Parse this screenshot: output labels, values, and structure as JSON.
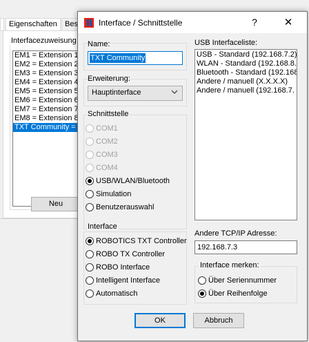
{
  "parent_window": {
    "tabs": [
      "Eigenschaften",
      "Besc"
    ],
    "left_tab_fragment": "",
    "group_label": "Interfacezuweisung",
    "list_items": [
      "EM1 = Extension 1",
      "EM2 = Extension 2",
      "EM3 = Extension 3",
      "EM4 = Extension 4",
      "EM5 = Extension 5",
      "EM6 = Extension 6",
      "EM7 = Extension 7",
      "EM8 = Extension 8",
      "TXT Community = T"
    ],
    "selected_index": 8,
    "new_button": "Neu"
  },
  "dialog": {
    "title": "Interface / Schnittstelle",
    "help_glyph": "?",
    "close_glyph": "✕",
    "name_label": "Name:",
    "name_value": "TXT Community",
    "extension_label": "Erweiterung:",
    "extension_value": "Hauptinterface",
    "port_group_label": "Schnittstelle",
    "port_options": [
      {
        "label": "COM1",
        "enabled": false,
        "checked": false
      },
      {
        "label": "COM2",
        "enabled": false,
        "checked": false
      },
      {
        "label": "COM3",
        "enabled": false,
        "checked": false
      },
      {
        "label": "COM4",
        "enabled": false,
        "checked": false
      },
      {
        "label": "USB/WLAN/Bluetooth",
        "enabled": true,
        "checked": true
      },
      {
        "label": "Simulation",
        "enabled": true,
        "checked": false
      },
      {
        "label": "Benutzerauswahl",
        "enabled": true,
        "checked": false
      }
    ],
    "interface_group_label": "Interface",
    "interface_options": [
      {
        "label": "ROBOTICS TXT Controller",
        "checked": true
      },
      {
        "label": "ROBO TX Controller",
        "checked": false
      },
      {
        "label": "ROBO Interface",
        "checked": false
      },
      {
        "label": "Intelligent Interface",
        "checked": false
      },
      {
        "label": "Automatisch",
        "checked": false
      }
    ],
    "usb_list_label": "USB Interfaceliste:",
    "usb_list_items": [
      "USB - Standard (192.168.7.2)",
      "WLAN - Standard (192.168.8.",
      "Bluetooth - Standard (192.168",
      "Andere / manuell (X.X.X.X)",
      "Andere / manuell (192.168.7."
    ],
    "tcp_label": "Andere TCP/IP Adresse:",
    "tcp_value": "192.168.7.3",
    "remember_group_label": "Interface merken:",
    "remember_options": [
      {
        "label": "Über Seriennummer",
        "checked": false
      },
      {
        "label": "Über Reihenfolge",
        "checked": true
      }
    ],
    "ok_label": "OK",
    "cancel_label": "Abbruch"
  },
  "colors": {
    "selection": "#0078d7",
    "dialog_bg": "#f0f0f0",
    "icon_red": "#e2231a",
    "icon_blue": "#1f4fa3"
  }
}
